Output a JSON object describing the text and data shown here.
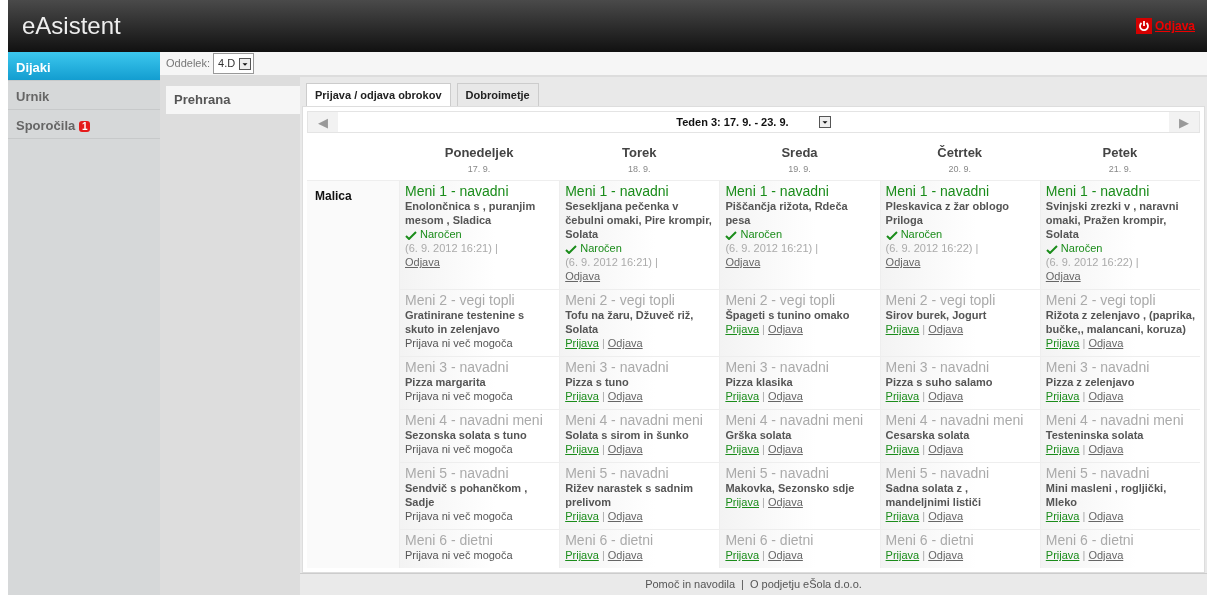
{
  "header": {
    "logo": "eAsistent",
    "logout": "Odjava"
  },
  "sidebar": {
    "items": [
      {
        "label": "Dijaki",
        "selected": true
      },
      {
        "label": "Urnik",
        "selected": false
      },
      {
        "label": "Sporočila",
        "selected": false,
        "badge": "1"
      }
    ]
  },
  "toolbar": {
    "label": "Oddelek:",
    "value": "4.D"
  },
  "subnav": {
    "items": [
      {
        "label": "Prehrana",
        "selected": true
      }
    ]
  },
  "tabs": [
    {
      "label": "Prijava / odjava obrokov",
      "selected": true
    },
    {
      "label": "Dobroimetje",
      "selected": false
    }
  ],
  "week": {
    "prev": "◀",
    "label": "Teden 3: 17. 9. - 23. 9.",
    "next": "▶"
  },
  "days": [
    {
      "name": "Ponedeljek",
      "date": "17. 9."
    },
    {
      "name": "Torek",
      "date": "18. 9."
    },
    {
      "name": "Sreda",
      "date": "19. 9."
    },
    {
      "name": "Četrtek",
      "date": "20. 9."
    },
    {
      "name": "Petek",
      "date": "21. 9."
    }
  ],
  "meal": "Malica",
  "rows": [
    {
      "cells": [
        {
          "title": "Meni 1 - navadni",
          "selected": true,
          "dish": "Enolončnica s , puranjim mesom , Sladica",
          "kind": "ordered",
          "status": "Naročen",
          "time": "(6. 9. 2012 16:21)",
          "sep": "|",
          "cancel": "Odjava"
        },
        {
          "title": "Meni 1 - navadni",
          "selected": true,
          "dish": "Sesekljana pečenka v čebulni omaki, Pire krompir, Solata",
          "kind": "ordered",
          "status": "Naročen",
          "time": "(6. 9. 2012 16:21)",
          "sep": "|",
          "cancel": "Odjava"
        },
        {
          "title": "Meni 1 - navadni",
          "selected": true,
          "dish": "Piščančja rižota, Rdeča pesa",
          "kind": "ordered",
          "status": "Naročen",
          "time": "(6. 9. 2012 16:21)",
          "sep": "|",
          "cancel": "Odjava"
        },
        {
          "title": "Meni 1 - navadni",
          "selected": true,
          "dish": "Pleskavica z žar oblogo Priloga",
          "kind": "ordered",
          "status": "Naročen",
          "time": "(6. 9. 2012 16:22)",
          "sep": "|",
          "cancel": "Odjava"
        },
        {
          "title": "Meni 1 - navadni",
          "selected": true,
          "dish": "Svinjski zrezki v , naravni omaki, Pražen krompir, Solata",
          "kind": "ordered",
          "status": "Naročen",
          "time": "(6. 9. 2012 16:22)",
          "sep": "|",
          "cancel": "Odjava"
        }
      ]
    },
    {
      "cells": [
        {
          "title": "Meni 2 - vegi topli",
          "selected": false,
          "dish": "Gratinirane testenine s skuto in zelenjavo",
          "kind": "closed",
          "note": "Prijava ni več mogoča"
        },
        {
          "title": "Meni 2 - vegi topli",
          "selected": false,
          "dish": "Tofu na žaru, Džuveč riž, Solata",
          "kind": "open",
          "signup": "Prijava",
          "sep": "|",
          "cancel": "Odjava"
        },
        {
          "title": "Meni 2 - vegi topli",
          "selected": false,
          "dish": "Špageti s tunino omako",
          "kind": "open",
          "signup": "Prijava",
          "sep": "|",
          "cancel": "Odjava"
        },
        {
          "title": "Meni 2 - vegi topli",
          "selected": false,
          "dish": "Sirov burek, Jogurt",
          "kind": "open",
          "signup": "Prijava",
          "sep": "|",
          "cancel": "Odjava"
        },
        {
          "title": "Meni 2 - vegi topli",
          "selected": false,
          "dish": "Rižota z zelenjavo , (paprika, bučke,, malancani, koruza)",
          "kind": "open",
          "signup": "Prijava",
          "sep": "|",
          "cancel": "Odjava"
        }
      ]
    },
    {
      "cells": [
        {
          "title": "Meni 3 - navadni",
          "selected": false,
          "dish": "Pizza margarita",
          "kind": "closed",
          "note": "Prijava ni več mogoča"
        },
        {
          "title": "Meni 3 - navadni",
          "selected": false,
          "dish": "Pizza s tuno",
          "kind": "open",
          "signup": "Prijava",
          "sep": "|",
          "cancel": "Odjava"
        },
        {
          "title": "Meni 3 - navadni",
          "selected": false,
          "dish": "Pizza klasika",
          "kind": "open",
          "signup": "Prijava",
          "sep": "|",
          "cancel": "Odjava"
        },
        {
          "title": "Meni 3 - navadni",
          "selected": false,
          "dish": "Pizza s suho salamo",
          "kind": "open",
          "signup": "Prijava",
          "sep": "|",
          "cancel": "Odjava"
        },
        {
          "title": "Meni 3 - navadni",
          "selected": false,
          "dish": "Pizza z zelenjavo",
          "kind": "open",
          "signup": "Prijava",
          "sep": "|",
          "cancel": "Odjava"
        }
      ]
    },
    {
      "cells": [
        {
          "title": "Meni 4 - navadni meni",
          "selected": false,
          "dish": "Sezonska solata s tuno",
          "kind": "closed",
          "note": "Prijava ni več mogoča"
        },
        {
          "title": "Meni 4 - navadni meni",
          "selected": false,
          "dish": "Solata s sirom in šunko",
          "kind": "open",
          "signup": "Prijava",
          "sep": "|",
          "cancel": "Odjava"
        },
        {
          "title": "Meni 4 - navadni meni",
          "selected": false,
          "dish": "Grška solata",
          "kind": "open",
          "signup": "Prijava",
          "sep": "|",
          "cancel": "Odjava"
        },
        {
          "title": "Meni 4 - navadni meni",
          "selected": false,
          "dish": "Cesarska solata",
          "kind": "open",
          "signup": "Prijava",
          "sep": "|",
          "cancel": "Odjava"
        },
        {
          "title": "Meni 4 - navadni meni",
          "selected": false,
          "dish": "Testeninska solata",
          "kind": "open",
          "signup": "Prijava",
          "sep": "|",
          "cancel": "Odjava"
        }
      ]
    },
    {
      "cells": [
        {
          "title": "Meni 5 - navadni",
          "selected": false,
          "dish": "Sendvič s pohančkom , Sadje",
          "kind": "closed",
          "note": "Prijava ni več mogoča"
        },
        {
          "title": "Meni 5 - navadni",
          "selected": false,
          "dish": "Rižev narastek s sadnim prelivom",
          "kind": "open",
          "signup": "Prijava",
          "sep": "|",
          "cancel": "Odjava"
        },
        {
          "title": "Meni 5 - navadni",
          "selected": false,
          "dish": "Makovka, Sezonsko sdje",
          "kind": "open",
          "signup": "Prijava",
          "sep": "|",
          "cancel": "Odjava"
        },
        {
          "title": "Meni 5 - navadni",
          "selected": false,
          "dish": "Sadna solata z , mandeljnimi lističi",
          "kind": "open",
          "signup": "Prijava",
          "sep": "|",
          "cancel": "Odjava"
        },
        {
          "title": "Meni 5 - navadni",
          "selected": false,
          "dish": "Mini masleni , rogljički, Mleko",
          "kind": "open",
          "signup": "Prijava",
          "sep": "|",
          "cancel": "Odjava"
        }
      ]
    },
    {
      "cells": [
        {
          "title": "Meni 6 - dietni",
          "selected": false,
          "kind": "closed",
          "note": "Prijava ni več mogoča"
        },
        {
          "title": "Meni 6 - dietni",
          "selected": false,
          "kind": "open",
          "signup": "Prijava",
          "sep": "|",
          "cancel": "Odjava"
        },
        {
          "title": "Meni 6 - dietni",
          "selected": false,
          "kind": "open",
          "signup": "Prijava",
          "sep": "|",
          "cancel": "Odjava"
        },
        {
          "title": "Meni 6 - dietni",
          "selected": false,
          "kind": "open",
          "signup": "Prijava",
          "sep": "|",
          "cancel": "Odjava"
        },
        {
          "title": "Meni 6 - dietni",
          "selected": false,
          "kind": "open",
          "signup": "Prijava",
          "sep": "|",
          "cancel": "Odjava"
        }
      ]
    }
  ],
  "footer": {
    "links": [
      "Pomoč in navodila",
      "O podjetju eŠola d.o.o."
    ],
    "sep": "|"
  }
}
